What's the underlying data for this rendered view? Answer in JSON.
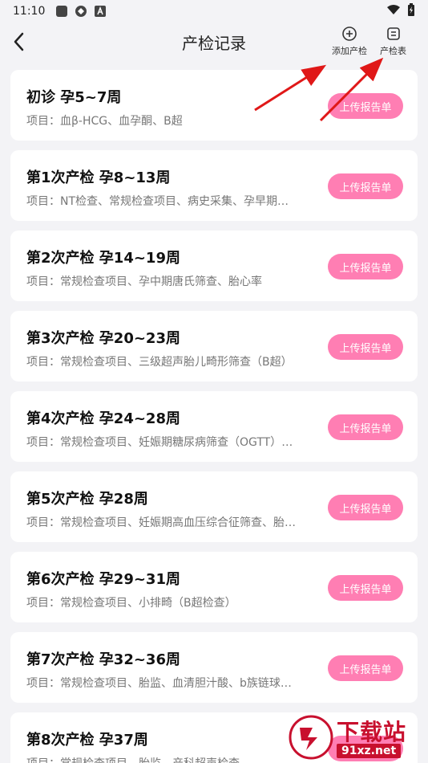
{
  "status_bar": {
    "time": "11:10"
  },
  "header": {
    "title": "产检记录",
    "add_label": "添加产检",
    "table_label": "产检表"
  },
  "records": [
    {
      "title": "初诊 孕5~7周",
      "items": "项目：血β-HCG、血孕酮、B超",
      "button": "上传报告单"
    },
    {
      "title": "第1次产检 孕8~13周",
      "items": "项目：NT检查、常规检查项目、病史采集、孕早期…",
      "button": "上传报告单"
    },
    {
      "title": "第2次产检 孕14~19周",
      "items": "项目：常规检查项目、孕中期唐氏筛查、胎心率",
      "button": "上传报告单"
    },
    {
      "title": "第3次产检 孕20~23周",
      "items": "项目：常规检查项目、三级超声胎儿畸形筛查（B超）",
      "button": "上传报告单"
    },
    {
      "title": "第4次产检 孕24~28周",
      "items": "项目：常规检查项目、妊娠期糖尿病筛查（OGTT）…",
      "button": "上传报告单"
    },
    {
      "title": "第5次产检 孕28周",
      "items": "项目：常规检查项目、妊娠期高血压综合征筛查、胎…",
      "button": "上传报告单"
    },
    {
      "title": "第6次产检 孕29~31周",
      "items": "项目：常规检查项目、小排畸（B超检查）",
      "button": "上传报告单"
    },
    {
      "title": "第7次产检 孕32~36周",
      "items": "项目：常规检查项目、胎监、血清胆汁酸、b族链球…",
      "button": "上传报告单"
    },
    {
      "title": "第8次产检 孕37周",
      "items": "项目：常规检查项目、胎监、产科超声检查",
      "button": "上传报告单"
    }
  ],
  "watermark": {
    "text_main": "下载站",
    "text_domain": "91xz.net"
  },
  "colors": {
    "accent": "#ff7eb3",
    "arrow": "#e01818",
    "watermark": "#c8102e"
  }
}
